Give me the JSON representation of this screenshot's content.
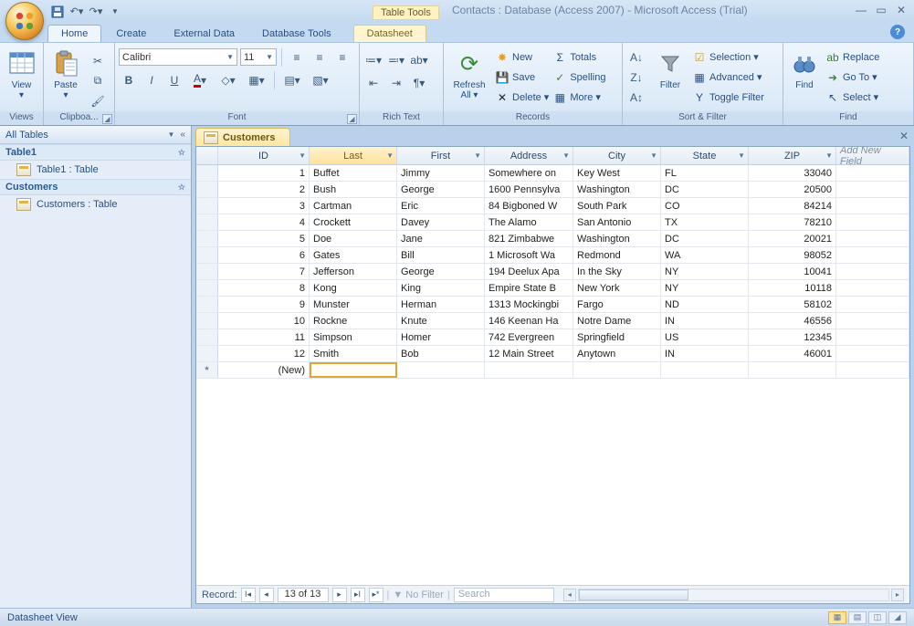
{
  "titlebar": {
    "table_tools": "Table Tools",
    "title": "Contacts : Database (Access 2007) - Microsoft Access (Trial)"
  },
  "tabs": {
    "home": "Home",
    "create": "Create",
    "external": "External Data",
    "dbtools": "Database Tools",
    "datasheet": "Datasheet"
  },
  "ribbon": {
    "views": {
      "label": "Views",
      "view": "View"
    },
    "clipboard": {
      "label": "Clipboa...",
      "paste": "Paste"
    },
    "font": {
      "label": "Font",
      "family": "Calibri",
      "size": "11"
    },
    "richtext": {
      "label": "Rich Text"
    },
    "records": {
      "label": "Records",
      "refresh": "Refresh All",
      "new": "New",
      "save": "Save",
      "delete": "Delete",
      "totals": "Totals",
      "spelling": "Spelling",
      "more": "More"
    },
    "sortfilter": {
      "label": "Sort & Filter",
      "filter": "Filter",
      "selection": "Selection",
      "advanced": "Advanced",
      "toggle": "Toggle Filter"
    },
    "find": {
      "label": "Find",
      "find": "Find",
      "replace": "Replace",
      "goto": "Go To",
      "select": "Select"
    }
  },
  "nav": {
    "header": "All Tables",
    "cat1": "Table1",
    "item1": "Table1 : Table",
    "cat2": "Customers",
    "item2": "Customers : Table"
  },
  "doc": {
    "tab": "Customers",
    "columns": {
      "id": "ID",
      "last": "Last",
      "first": "First",
      "address": "Address",
      "city": "City",
      "state": "State",
      "zip": "ZIP",
      "addnew": "Add New Field"
    },
    "rows": [
      {
        "id": "1",
        "last": "Buffet",
        "first": "Jimmy",
        "address": "Somewhere on",
        "city": "Key West",
        "state": "FL",
        "zip": "33040"
      },
      {
        "id": "2",
        "last": "Bush",
        "first": "George",
        "address": "1600 Pennsylva",
        "city": "Washington",
        "state": "DC",
        "zip": "20500"
      },
      {
        "id": "3",
        "last": "Cartman",
        "first": "Eric",
        "address": "84 Bigboned W",
        "city": "South Park",
        "state": "CO",
        "zip": "84214"
      },
      {
        "id": "4",
        "last": "Crockett",
        "first": "Davey",
        "address": "The Alamo",
        "city": "San Antonio",
        "state": "TX",
        "zip": "78210"
      },
      {
        "id": "5",
        "last": "Doe",
        "first": "Jane",
        "address": "821 Zimbabwe",
        "city": "Washington",
        "state": "DC",
        "zip": "20021"
      },
      {
        "id": "6",
        "last": "Gates",
        "first": "Bill",
        "address": "1 Microsoft Wa",
        "city": "Redmond",
        "state": "WA",
        "zip": "98052"
      },
      {
        "id": "7",
        "last": "Jefferson",
        "first": "George",
        "address": "194 Deelux Apa",
        "city": "In the Sky",
        "state": "NY",
        "zip": "10041"
      },
      {
        "id": "8",
        "last": "Kong",
        "first": "King",
        "address": "Empire State B",
        "city": "New York",
        "state": "NY",
        "zip": "10118"
      },
      {
        "id": "9",
        "last": "Munster",
        "first": "Herman",
        "address": "1313 Mockingbi",
        "city": "Fargo",
        "state": "ND",
        "zip": "58102"
      },
      {
        "id": "10",
        "last": "Rockne",
        "first": "Knute",
        "address": "146 Keenan Ha",
        "city": "Notre Dame",
        "state": "IN",
        "zip": "46556"
      },
      {
        "id": "11",
        "last": "Simpson",
        "first": "Homer",
        "address": "742 Evergreen",
        "city": "Springfield",
        "state": "US",
        "zip": "12345"
      },
      {
        "id": "12",
        "last": "Smith",
        "first": "Bob",
        "address": "12 Main Street",
        "city": "Anytown",
        "state": "IN",
        "zip": "46001"
      }
    ],
    "newrow": "(New)",
    "recnav": {
      "label": "Record:",
      "pos": "13 of 13",
      "nofilter": "No Filter",
      "search": "Search"
    }
  },
  "status": {
    "text": "Datasheet View"
  }
}
